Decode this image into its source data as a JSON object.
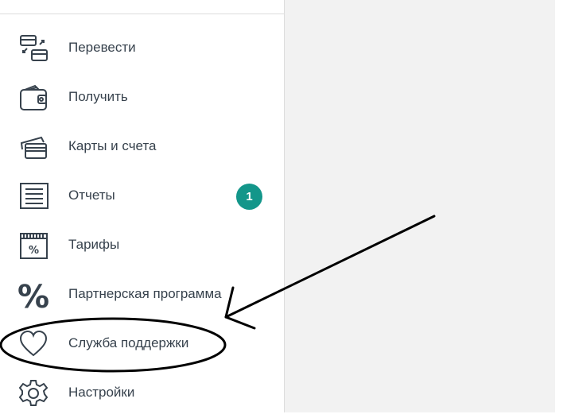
{
  "menu": {
    "items": [
      {
        "label": "Перевести",
        "icon": "transfer-icon"
      },
      {
        "label": "Получить",
        "icon": "wallet-icon"
      },
      {
        "label": "Карты и счета",
        "icon": "cards-icon"
      },
      {
        "label": "Отчеты",
        "icon": "report-icon",
        "badge": "1"
      },
      {
        "label": "Тарифы",
        "icon": "tariff-calendar-icon"
      },
      {
        "label": "Партнерская программа",
        "icon": "percent-icon"
      },
      {
        "label": "Служба поддержки",
        "icon": "heart-icon"
      },
      {
        "label": "Настройки",
        "icon": "gear-icon"
      }
    ]
  },
  "colors": {
    "badge": "#13968a",
    "text": "#37424d",
    "icon": "#37424d",
    "main_background": "#f2f2f2"
  }
}
